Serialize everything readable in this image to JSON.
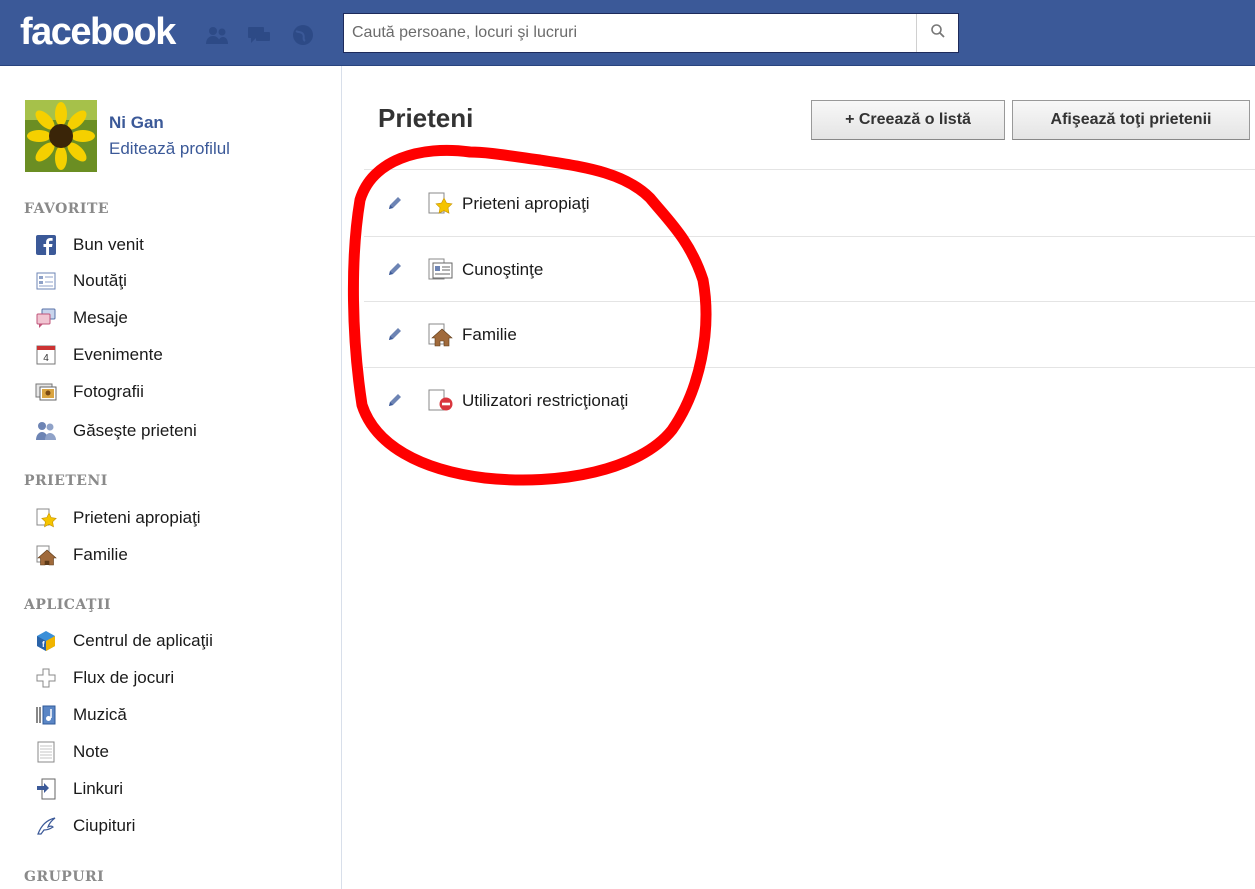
{
  "header": {
    "logo": "facebook",
    "search": {
      "placeholder": "Caută persoane, locuri şi lucruri"
    }
  },
  "profile": {
    "name": "Ni Gan",
    "edit_link": "Editează profilul"
  },
  "sidebar": {
    "favorites": {
      "heading": "FAVORITE",
      "items": [
        {
          "label": "Bun venit",
          "icon": "facebook-f-icon"
        },
        {
          "label": "Noutăţi",
          "icon": "news-feed-icon"
        },
        {
          "label": "Mesaje",
          "icon": "messages-icon"
        },
        {
          "label": "Evenimente",
          "icon": "calendar-icon",
          "badge": "4"
        },
        {
          "label": "Fotografii",
          "icon": "photos-icon"
        },
        {
          "label": "Găseşte prieteni",
          "icon": "find-friends-icon"
        }
      ]
    },
    "friends": {
      "heading": "PRIETENI",
      "items": [
        {
          "label": "Prieteni apropiaţi",
          "icon": "star-list-icon"
        },
        {
          "label": "Familie",
          "icon": "house-icon"
        }
      ]
    },
    "apps": {
      "heading": "APLICAŢII",
      "items": [
        {
          "label": "Centrul de aplicaţii",
          "icon": "app-center-icon"
        },
        {
          "label": "Flux de jocuri",
          "icon": "games-icon"
        },
        {
          "label": "Muzică",
          "icon": "music-icon"
        },
        {
          "label": "Note",
          "icon": "notes-icon"
        },
        {
          "label": "Linkuri",
          "icon": "links-icon"
        },
        {
          "label": "Ciupituri",
          "icon": "pokes-icon"
        }
      ]
    },
    "groups": {
      "heading": "GRUPURI"
    }
  },
  "main": {
    "title": "Prieteni",
    "create_list_button": "+ Creează o listă",
    "show_all_button": "Afişează toţi prietenii",
    "lists": [
      {
        "label": "Prieteni apropiaţi",
        "icon": "star-list-icon"
      },
      {
        "label": "Cunoştinţe",
        "icon": "acquaintances-icon"
      },
      {
        "label": "Familie",
        "icon": "house-icon"
      },
      {
        "label": "Utilizatori restricţionaţi",
        "icon": "restricted-icon"
      }
    ]
  },
  "colors": {
    "header_bg": "#3b5998",
    "link": "#3b5998",
    "annotation": "#ff0000"
  }
}
